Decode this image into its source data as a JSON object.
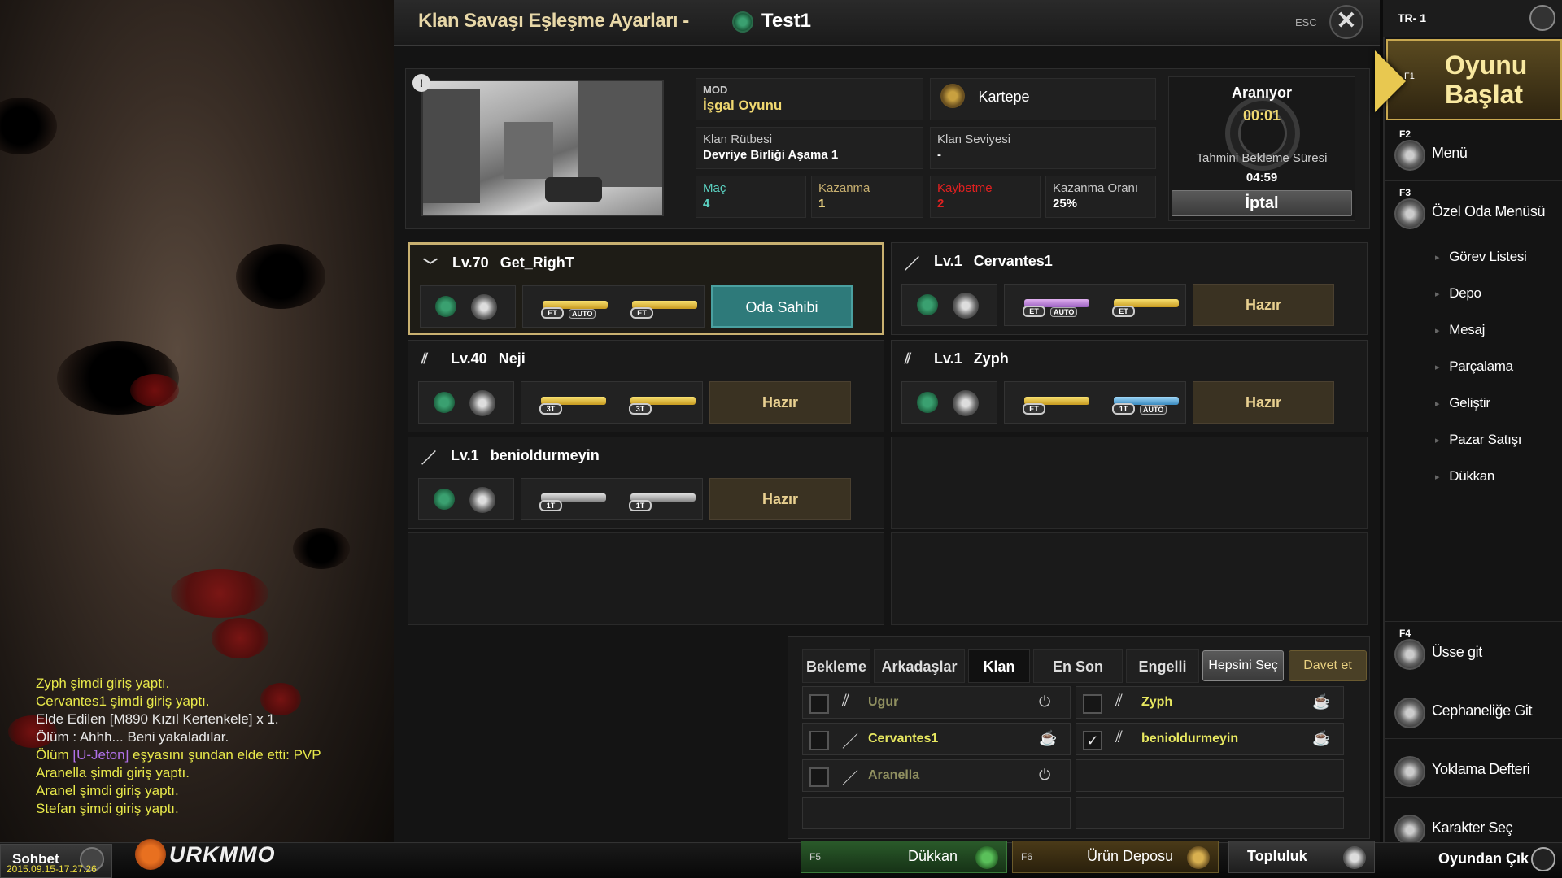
{
  "window": {
    "title": "Klan Savaşı Eşleşme Ayarları -",
    "room_name": "Test1",
    "esc_label": "ESC",
    "close_label": "✕"
  },
  "info": {
    "mode_key": "MOD",
    "mode_val": "İşgal Oyunu",
    "map_name": "Kartepe",
    "rank_key": "Klan Rütbesi",
    "rank_val": "Devriye Birliği Aşama 1",
    "level_key": "Klan Seviyesi",
    "level_val": "-",
    "match_key": "Maç",
    "match_val": "4",
    "win_key": "Kazanma",
    "win_val": "1",
    "lose_key": "Kaybetme",
    "lose_val": "2",
    "rate_key": "Kazanma Oranı",
    "rate_val": "25%",
    "info_icon": "!"
  },
  "search": {
    "label": "Aranıyor",
    "timer": "00:01",
    "wait_label": "Tahmini Bekleme Süresi",
    "wait_value": "04:59",
    "cancel_label": "İptal"
  },
  "players": [
    {
      "level": "Lv.70",
      "name": "Get_RighT",
      "status": "Oda Sahibi",
      "host": true,
      "rank_icon": "chevron",
      "guns": [
        {
          "tier": "ET",
          "auto": "AUTO",
          "color": "gold"
        },
        {
          "tier": "ET",
          "auto": "",
          "color": "gold"
        }
      ]
    },
    {
      "level": "Lv.1",
      "name": "Cervantes1",
      "status": "Hazır",
      "host": false,
      "rank_icon": "slash",
      "guns": [
        {
          "tier": "ET",
          "auto": "AUTO",
          "color": "purple"
        },
        {
          "tier": "ET",
          "auto": "",
          "color": "gold"
        }
      ]
    },
    {
      "level": "Lv.40",
      "name": "Neji",
      "status": "Hazır",
      "host": false,
      "rank_icon": "double-slash",
      "guns": [
        {
          "tier": "3T",
          "auto": "",
          "color": "gold"
        },
        {
          "tier": "3T",
          "auto": "",
          "color": "gold"
        }
      ]
    },
    {
      "level": "Lv.1",
      "name": "Zyph",
      "status": "Hazır",
      "host": false,
      "rank_icon": "double-slash",
      "guns": [
        {
          "tier": "ET",
          "auto": "",
          "color": "gold"
        },
        {
          "tier": "1T",
          "auto": "AUTO",
          "color": "blue"
        }
      ]
    },
    {
      "level": "Lv.1",
      "name": "benioldurmeyin",
      "status": "Hazır",
      "host": false,
      "rank_icon": "slash",
      "guns": [
        {
          "tier": "1T",
          "auto": "",
          "color": "silver"
        },
        {
          "tier": "1T",
          "auto": "",
          "color": "silver"
        }
      ]
    }
  ],
  "chat": [
    {
      "text": "Zyph şimdi giriş yaptı.",
      "color": "yellow"
    },
    {
      "text": "Cervantes1 şimdi giriş yaptı.",
      "color": "yellow"
    },
    {
      "text": "Elde Edilen [M890 Kızıl Kertenkele] x 1.",
      "color": "white"
    },
    {
      "text": "Ölüm : Ahhh... Beni yakaladılar.",
      "color": "white"
    },
    {
      "text": "Ölüm",
      "extra": " [U-Jeton]",
      "tail": " eşyasını şundan elde etti: PVP",
      "color": "mixed"
    },
    {
      "text": "Aranella şimdi giriş yaptı.",
      "color": "yellow"
    },
    {
      "text": "Aranel şimdi giriş yaptı.",
      "color": "yellow"
    },
    {
      "text": "Stefan şimdi giriş yaptı.",
      "color": "yellow"
    }
  ],
  "friends": {
    "tabs": [
      "Bekleme",
      "Arkadaşlar",
      "Klan",
      "En Son",
      "Engelli"
    ],
    "active_tab": "Klan",
    "select_all": "Hepsini Seç",
    "invite": "Davet et",
    "list": [
      {
        "name": "Ugur",
        "online": false,
        "checked": false
      },
      {
        "name": "Zyph",
        "online": true,
        "checked": false
      },
      {
        "name": "Cervantes1",
        "online": true,
        "checked": false
      },
      {
        "name": "benioldurmeyin",
        "online": true,
        "checked": true
      },
      {
        "name": "Aranella",
        "online": false,
        "checked": false
      }
    ]
  },
  "bottom": {
    "chat_label": "Sohbet",
    "logo": "URKMMO",
    "timestamp": "2015.09.15-17.27.26",
    "shop_key": "F5",
    "shop_label": "Dükkan",
    "depot_key": "F6",
    "depot_label": "Ürün Deposu",
    "community_label": "Topluluk",
    "quit_label": "Oyundan Çık"
  },
  "sidebar": {
    "server": "TR- 1",
    "start_label_1": "Oyunu",
    "start_label_2": "Başlat",
    "start_key": "F1",
    "menu_key": "F2",
    "menu_label": "Menü",
    "room_menu_key": "F3",
    "room_menu_label": "Özel Oda Menüsü",
    "sub_items": [
      "Görev Listesi",
      "Depo",
      "Mesaj",
      "Parçalama",
      "Geliştir",
      "Pazar Satışı",
      "Dükkan"
    ],
    "base_key": "F4",
    "base_label": "Üsse git",
    "armory_label": "Cephaneliğe Git",
    "attendance_label": "Yoklama Defteri",
    "char_label": "Karakter Seç"
  },
  "colors": {
    "accent_gold": "#c8b070",
    "host_teal": "#2e7a7a",
    "win_teal": "#5ad0c0",
    "lose_red": "#e02020",
    "chat_yellow": "#e8e84a"
  }
}
